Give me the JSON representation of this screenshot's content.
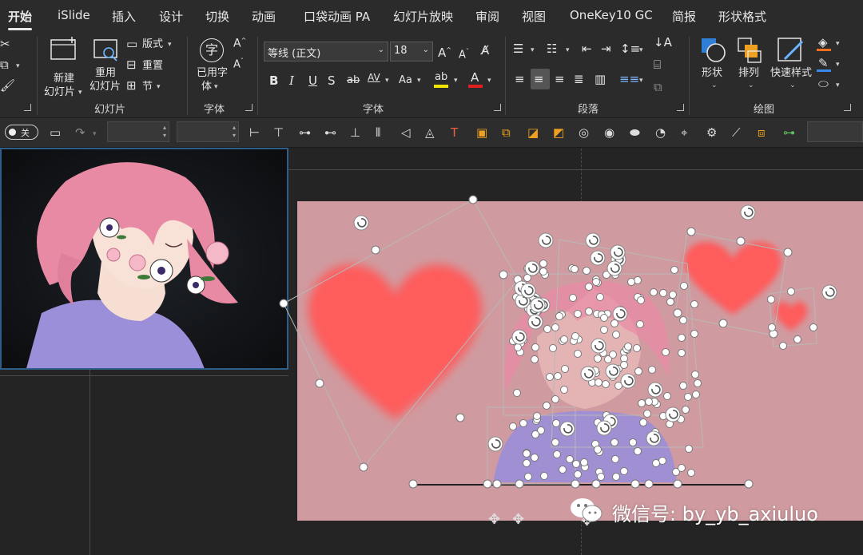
{
  "tabs": [
    {
      "label": "开始",
      "active": true
    },
    {
      "label": "iSlide"
    },
    {
      "label": "插入"
    },
    {
      "label": "设计"
    },
    {
      "label": "切换"
    },
    {
      "label": "动画"
    },
    {
      "label": "口袋动画 PA"
    },
    {
      "label": "幻灯片放映"
    },
    {
      "label": "审阅"
    },
    {
      "label": "视图"
    },
    {
      "label": "OneKey10 GC"
    },
    {
      "label": "简报"
    },
    {
      "label": "形状格式"
    }
  ],
  "ribbon": {
    "slides": {
      "group_label": "幻灯片",
      "new_slide_line1": "新建",
      "new_slide_line2": "幻灯片",
      "reuse_line1": "重用",
      "reuse_line2": "幻灯片",
      "layout": "版式",
      "reset": "重置",
      "section": "节"
    },
    "font_apply": {
      "group_label": "字体",
      "apply_line1": "已用字",
      "apply_line2": "体",
      "glyph": "字"
    },
    "font": {
      "group_label": "字体",
      "font_name": "等线 (正文)",
      "font_size": "18",
      "grow": "A",
      "shrink": "A",
      "bold": "B",
      "italic": "I",
      "underline": "U",
      "shadow": "S",
      "strike": "ab",
      "spacing": "AV",
      "case": "Aa",
      "highlight": "ab",
      "color": "A",
      "highlight_color": "#f2e600",
      "font_color": "#e02020"
    },
    "paragraph": {
      "group_label": "段落"
    },
    "drawing": {
      "group_label": "绘图",
      "shapes": "形状",
      "arrange": "排列",
      "quick_styles": "快速样式"
    }
  },
  "quick_toolbar": {
    "toggle_label": "关"
  },
  "watermark": {
    "text": "微信号: by_yb_axiuluo"
  },
  "colors": {
    "slide_bg": "#cf9ba0",
    "heart": "#ff5b5b",
    "accent_blue": "#2f5d8a"
  }
}
